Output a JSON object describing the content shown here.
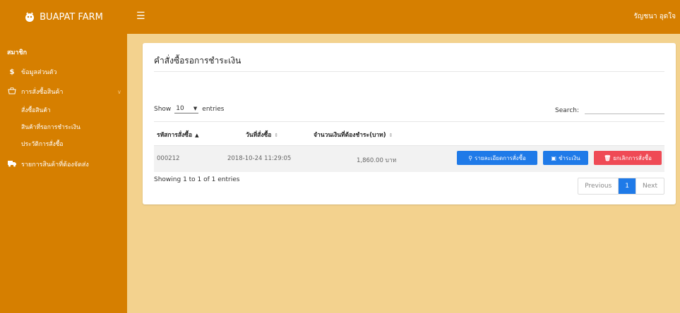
{
  "topbar": {
    "brand": "BUAPAT FARM",
    "menu_icon": "hamburger-icon",
    "user_name": "รัญชนา อุดใจ"
  },
  "sidebar": {
    "section_title": "สมาชิก",
    "items": [
      {
        "icon": "dollar-icon",
        "label": "ข้อมูลส่วนตัว"
      },
      {
        "icon": "shopping-bag-icon",
        "label": "การสั่งซื้อสินค้า"
      },
      {
        "icon": "truck-icon",
        "label": "รายการสินค้าที่ต้องจัดส่ง"
      }
    ],
    "subitems": [
      {
        "label": "สั่งซื้อสินค้า"
      },
      {
        "label": "สินค้าที่รอการชำระเงิน"
      },
      {
        "label": "ประวัติการสั่งซื้อ"
      }
    ]
  },
  "card": {
    "title": "คำสั่งซื้อรอการชำระเงิน"
  },
  "table_controls": {
    "show_label": "Show",
    "length_value": "10",
    "entries_label": "entries",
    "search_label": "Search:",
    "search_value": ""
  },
  "table": {
    "columns": [
      "รหัสการสั่งซื้อ",
      "วันที่สั่งซื้อ",
      "จำนวนเงินที่ต้องชำระ(บาท)"
    ],
    "rows": [
      {
        "order_id": "000212",
        "date": "2018-10-24 11:29:05",
        "amount": "1,860.00 บาท"
      }
    ],
    "actions": {
      "details": "รายละเอียดการสั่งซื้อ",
      "pay": "ชำระเงิน",
      "cancel": "ยกเลิกการสั่งซื้อ"
    }
  },
  "footer": {
    "info": "Showing 1 to 1 of 1 entries",
    "previous": "Previous",
    "current_page": "1",
    "next": "Next"
  },
  "colors": {
    "primary_orange": "#d67f00",
    "background": "#f3d28e",
    "button_blue": "#1f7ae8",
    "button_red": "#ef4a55"
  }
}
